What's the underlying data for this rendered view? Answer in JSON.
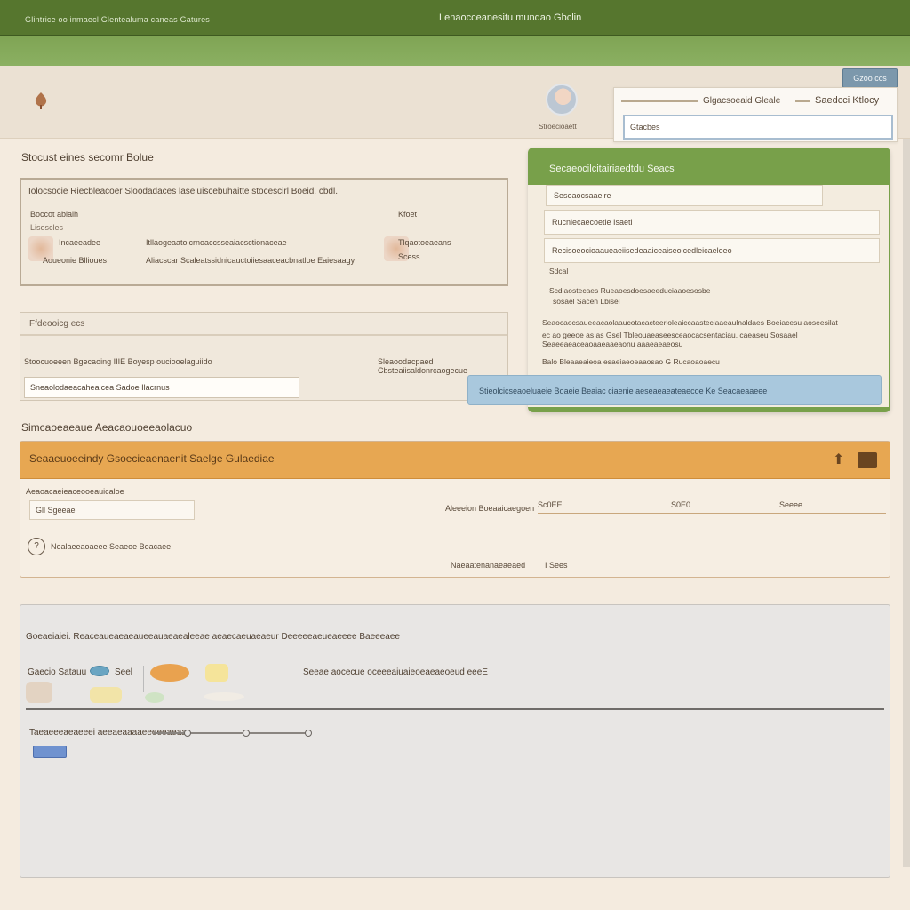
{
  "topbar": {
    "left_title": "Glintrice oo inmaecl Glentealuma caneas Gatures",
    "center_title": "Lenaocceanesitu mundao Gbclin"
  },
  "header": {
    "avatar_label": "Stroecioaett",
    "top_button": "Gzoo ccs"
  },
  "search": {
    "label1": "Glgacsoeaid Gleale",
    "label2": "Saedcci Ktlocy",
    "value": "Gtacbes"
  },
  "section1": {
    "title": "Stocust eines secomr  Bolue",
    "card": {
      "header": "Iolocsocie Riecbleacoer Sloodadaces laseiuiscebuhaitte stocescirl Boeid. cbdl.",
      "col1": "Boccot ablalh",
      "col2": "Kfoet",
      "sub1": "Lisoscles",
      "r1a": "Incaeeadee",
      "r1b": "Itllaogeaatoicrnoaccsseaiacsctionaceae",
      "r1c": "Tlqaotoeaeans",
      "r2a": "Aoueonie Bllioues",
      "r2b": "Aliacscar Scaleatssidnicauctoiiesaaceacbnatloe Eaiesaagy",
      "r2c": "Scess"
    }
  },
  "section2": {
    "header": "Ffdeooicg ecs",
    "row_left": "Stoocuoeeen Bgecaoing IIIE Boyesp ouciooelaguiido",
    "row_right": "Sleaoodacpaed Cbsteaiisaldonrcaogecue",
    "field": "Sneaolodaeacaheaicea Sadoe Ilacrnus"
  },
  "side_panel": {
    "title": "Secaeocilcitairiaedtdu Seacs",
    "input1": "Seseaocsaaeire",
    "input2": "Rucniecaecoetie Isaeti",
    "input3": "Recisoeocioaaueaeiisedeaaiceaiseoicedleicaeloeo",
    "t1": "Sdcal",
    "t2": "Scdiaostecaes Rueaoesdoesaeeduciaaoesosbe",
    "t3": "sosael Sacen Lbisel",
    "t4": "Seaocaocsaueeacaolaaucotacacteerioleaiccaasteciaaeaulnaldaes Boeiacesu aoseesilat",
    "t5": "ec ao geeoe as as  Gsel Tbleouaeaseesceaocacsentaciau. caeaseu  Sosaael  Seaeeaeaceaoaaeaaeaonu  aaaeaeaeosu",
    "t6": "Balo Bleaaeaieoa esaeiaeoeaaosao  G  Rucaoaoaecu"
  },
  "blue_bar": "Stieolcicseaoeluaeie Boaeie Beaiac ciaenie aeseaeaeateaecoe Ke Seacaeaaeee",
  "section3": {
    "title": "Simcaoeaeaue Aeacaouoeeaolacuo",
    "header": "Seaaeuoeeindy Gsoecieaenaenit Saelge Gulaediae",
    "t1": "Aeaoacaeieaceooeauicaloe",
    "input": "Gll Sgeeae",
    "t2": "Aleeeion Boeaaicaegoen",
    "c1": "Sc0EE",
    "c2": "S0E0",
    "c3": "Seeee",
    "help_text": "Nealaeeaoaeee Seaeoe Boacaee",
    "t3": "Naeaatenanaeaeaed",
    "t4": "I Sees"
  },
  "section4": {
    "header": "Goeaeiaiei. Reaceaueaeaeaueeauaeaealeeae aeaecaeuaeaeur Deeeeeaeueaeeee Baeeeaee",
    "label1": "Gaecio Satauu",
    "label2": "Seel",
    "label3": "Seeae aocecue oceeeaiuaieoeaeaeoeud eeeE",
    "stepper_label": "Taeaeeeaeaeeei aeeaeaaaaeeeeeaeaa"
  }
}
